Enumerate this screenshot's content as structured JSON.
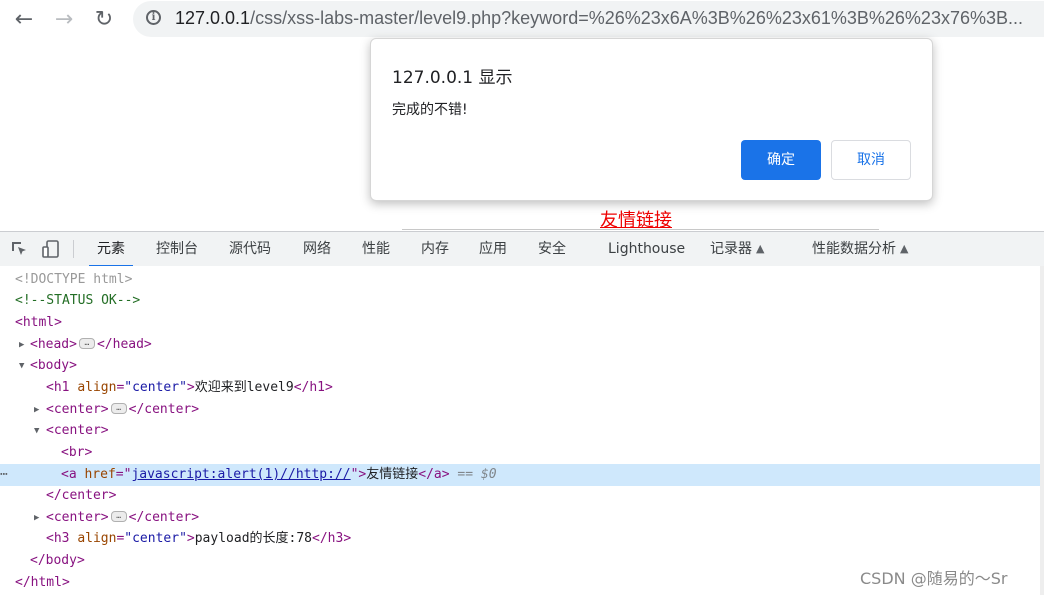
{
  "browser": {
    "url_host": "127.0.0.1",
    "url_rest": "/css/xss-labs-master/level9.php?keyword=%26%23x6A%3B%26%23x61%3B%26%23x76%3B..."
  },
  "page": {
    "link_text": "友情链接"
  },
  "dialog": {
    "title": "127.0.0.1 显示",
    "message": "完成的不错!",
    "ok_label": "确定",
    "cancel_label": "取消"
  },
  "devtools": {
    "tabs": [
      "元素",
      "控制台",
      "源代码",
      "网络",
      "性能",
      "内存",
      "应用",
      "安全",
      "Lighthouse",
      "记录器",
      "性能数据分析"
    ],
    "active_tab": "元素",
    "dom": {
      "doctype": "<!DOCTYPE html>",
      "comment": "<!--STATUS OK-->",
      "html_open": "<html>",
      "head_open": "<head>",
      "head_close": "</head>",
      "body_open": "<body>",
      "h1_attr_name": "align",
      "h1_attr_value": "\"center\"",
      "h1_text": "欢迎来到level9",
      "center_open": "<center>",
      "center_close": "</center>",
      "br": "<br>",
      "a_attr_name": "href",
      "a_href": "javascript:alert(1)//http://",
      "a_text": "友情链接",
      "selected_marker": "== $0",
      "h3_attr_value": "\"center\"",
      "h3_text": "payload的长度:78",
      "body_close": "</body>",
      "html_close": "</html>"
    }
  },
  "watermark": "CSDN @随易的～Sr"
}
